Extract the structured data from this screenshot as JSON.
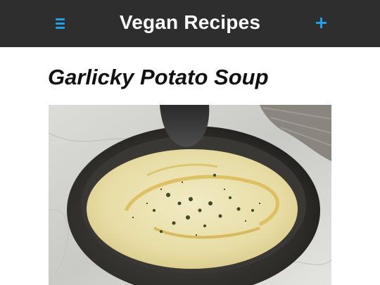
{
  "header": {
    "title": "Vegan Recipes",
    "menu_icon": "hamburger-menu-icon",
    "add_icon": "plus-icon",
    "accent_color": "#1ea0e8",
    "background_color": "#2e2e2e"
  },
  "recipe": {
    "title": "Garlicky Potato Soup"
  }
}
